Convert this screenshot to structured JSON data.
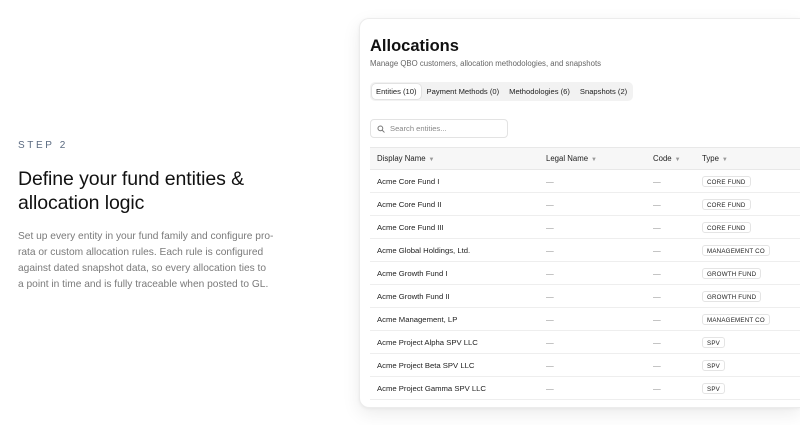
{
  "intro": {
    "step": "STEP 2",
    "headline": "Define your fund entities & allocation logic",
    "description": "Set up every entity in your fund family and configure pro-rata or custom allocation rules. Each rule is configured against dated snapshot data, so every allocation ties to a point in time and is fully traceable when posted to GL."
  },
  "window": {
    "title": "Allocations",
    "subtitle": "Manage QBO customers, allocation methodologies, and snapshots",
    "tabs": [
      {
        "label": "Entities (10)",
        "active": true
      },
      {
        "label": "Payment Methods (0)",
        "active": false
      },
      {
        "label": "Methodologies (6)",
        "active": false
      },
      {
        "label": "Snapshots (2)",
        "active": false
      }
    ],
    "search": {
      "placeholder": "Search entities..."
    },
    "table": {
      "columns": [
        "Display Name",
        "Legal Name",
        "Code",
        "Type"
      ],
      "rows": [
        {
          "display_name": "Acme Core Fund I",
          "legal_name": "—",
          "code": "—",
          "type": "CORE FUND"
        },
        {
          "display_name": "Acme Core Fund II",
          "legal_name": "—",
          "code": "—",
          "type": "CORE FUND"
        },
        {
          "display_name": "Acme Core Fund III",
          "legal_name": "—",
          "code": "—",
          "type": "CORE FUND"
        },
        {
          "display_name": "Acme Global Holdings, Ltd.",
          "legal_name": "—",
          "code": "—",
          "type": "MANAGEMENT CO"
        },
        {
          "display_name": "Acme Growth Fund I",
          "legal_name": "—",
          "code": "—",
          "type": "GROWTH FUND"
        },
        {
          "display_name": "Acme Growth Fund II",
          "legal_name": "—",
          "code": "—",
          "type": "GROWTH FUND"
        },
        {
          "display_name": "Acme Management, LP",
          "legal_name": "—",
          "code": "—",
          "type": "MANAGEMENT CO"
        },
        {
          "display_name": "Acme Project Alpha SPV LLC",
          "legal_name": "—",
          "code": "—",
          "type": "SPV"
        },
        {
          "display_name": "Acme Project Beta SPV LLC",
          "legal_name": "—",
          "code": "—",
          "type": "SPV"
        },
        {
          "display_name": "Acme Project Gamma SPV LLC",
          "legal_name": "—",
          "code": "—",
          "type": "SPV"
        }
      ]
    }
  },
  "icons": {
    "search": "search-icon",
    "sort": "sort-caret-icon"
  }
}
